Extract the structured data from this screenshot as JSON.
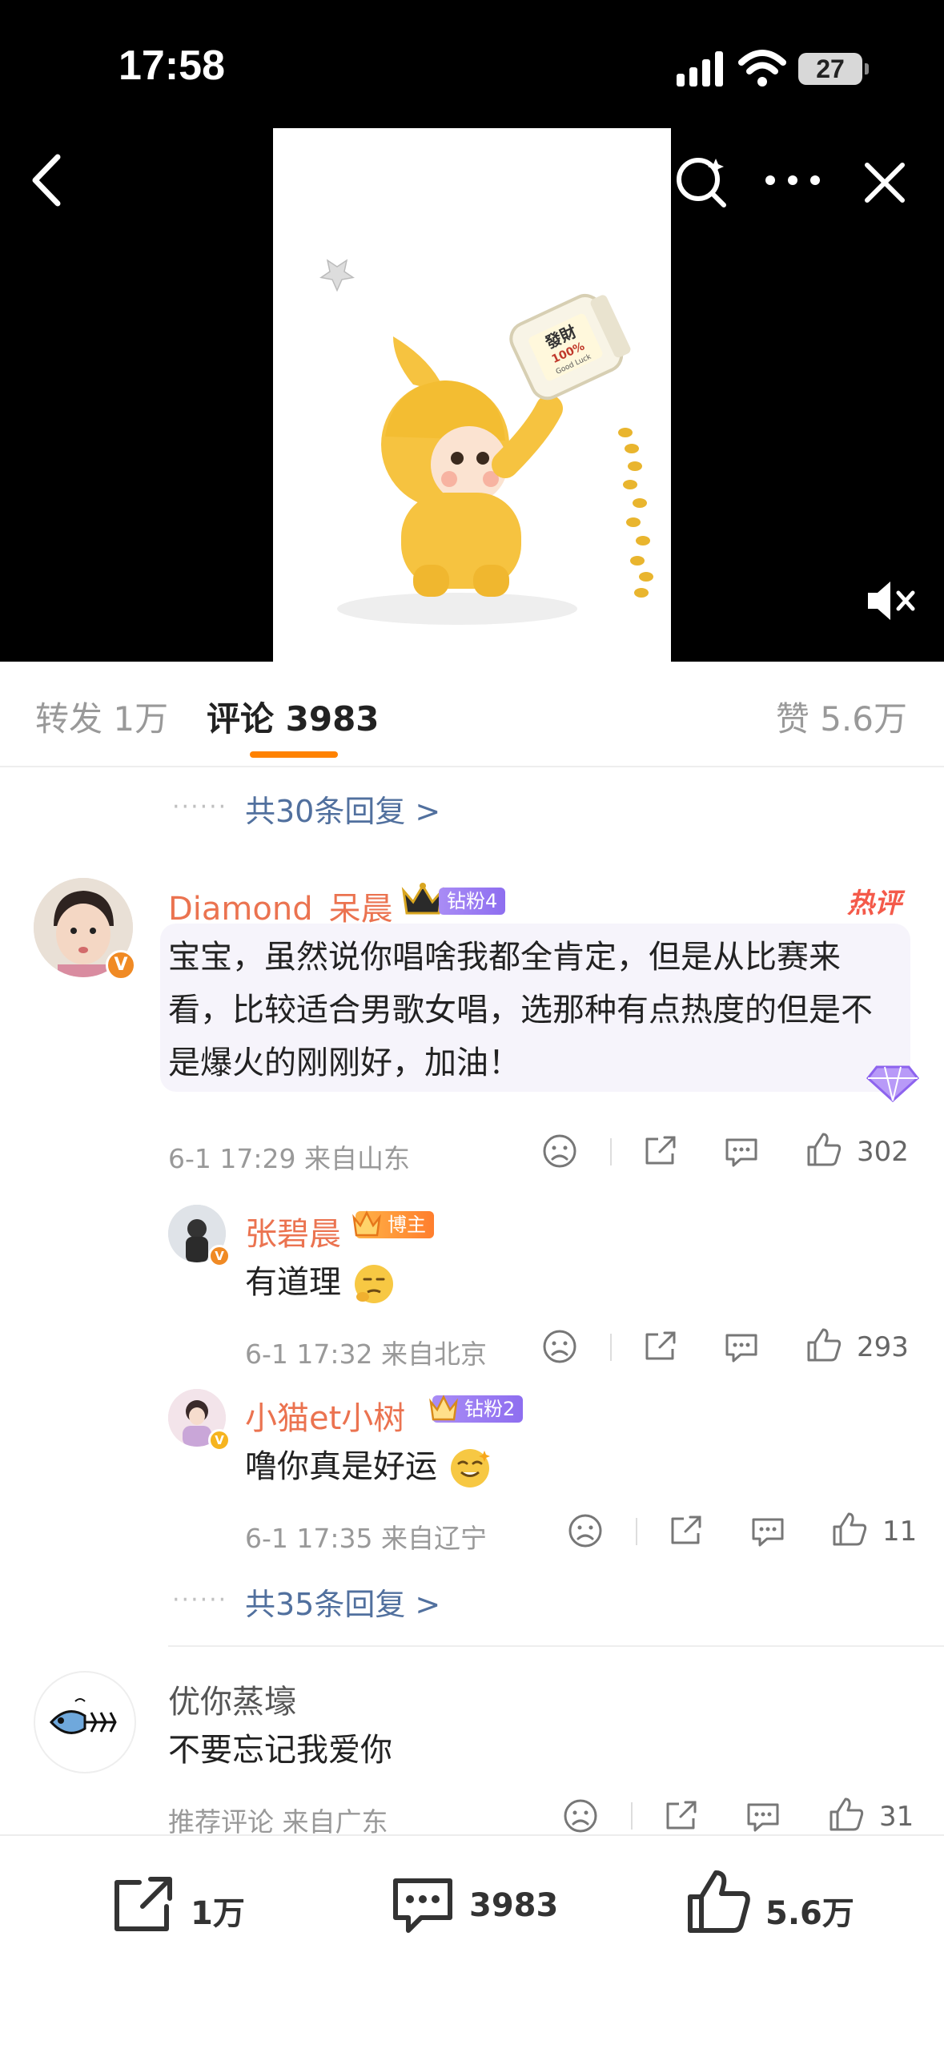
{
  "status_bar": {
    "time": "17:58",
    "battery": "27"
  },
  "post_media": {
    "jar_text_main": "發財",
    "jar_text_pct": "100%",
    "jar_text_luck": "Good Luck"
  },
  "tabs": {
    "forward": "转发 1万",
    "comment_prefix": "评论",
    "comment_count": "3983",
    "like": "赞 5.6万"
  },
  "prev_more_replies": "共30条回复 >",
  "hot_comment": {
    "username": "Diamond_呆晨",
    "fan_badge": "钻粉4",
    "hot_label": "热评",
    "text": "宝宝，虽然说你唱啥我都全肯定，但是从比赛来看，比较适合男歌女唱，选那种有点热度的但是不是爆火的刚刚好，加油！",
    "time": "6-1 17:29",
    "location": "来自山东",
    "likes": "302"
  },
  "replies": [
    {
      "username": "张碧晨",
      "badge": "博主",
      "text": "有道理",
      "time": "6-1 17:32",
      "location": "来自北京",
      "likes": "293"
    },
    {
      "username": "小猫et小树",
      "badge": "钻粉2",
      "text": "噜你真是好运",
      "time": "6-1 17:35",
      "location": "来自辽宁",
      "likes": "11"
    }
  ],
  "hot_more_replies": "共35条回复 >",
  "second_comment": {
    "username": "优你蒸壕",
    "text": "不要忘记我爱你",
    "tag": "推荐评论",
    "location": "来自广东",
    "likes": "31"
  },
  "bottom_bar": {
    "forward": "1万",
    "comment": "3983",
    "like": "5.6万"
  },
  "colors": {
    "accent": "#ff8200",
    "username": "#eb7350",
    "link": "#51709e",
    "hot": "#f45a4a"
  }
}
